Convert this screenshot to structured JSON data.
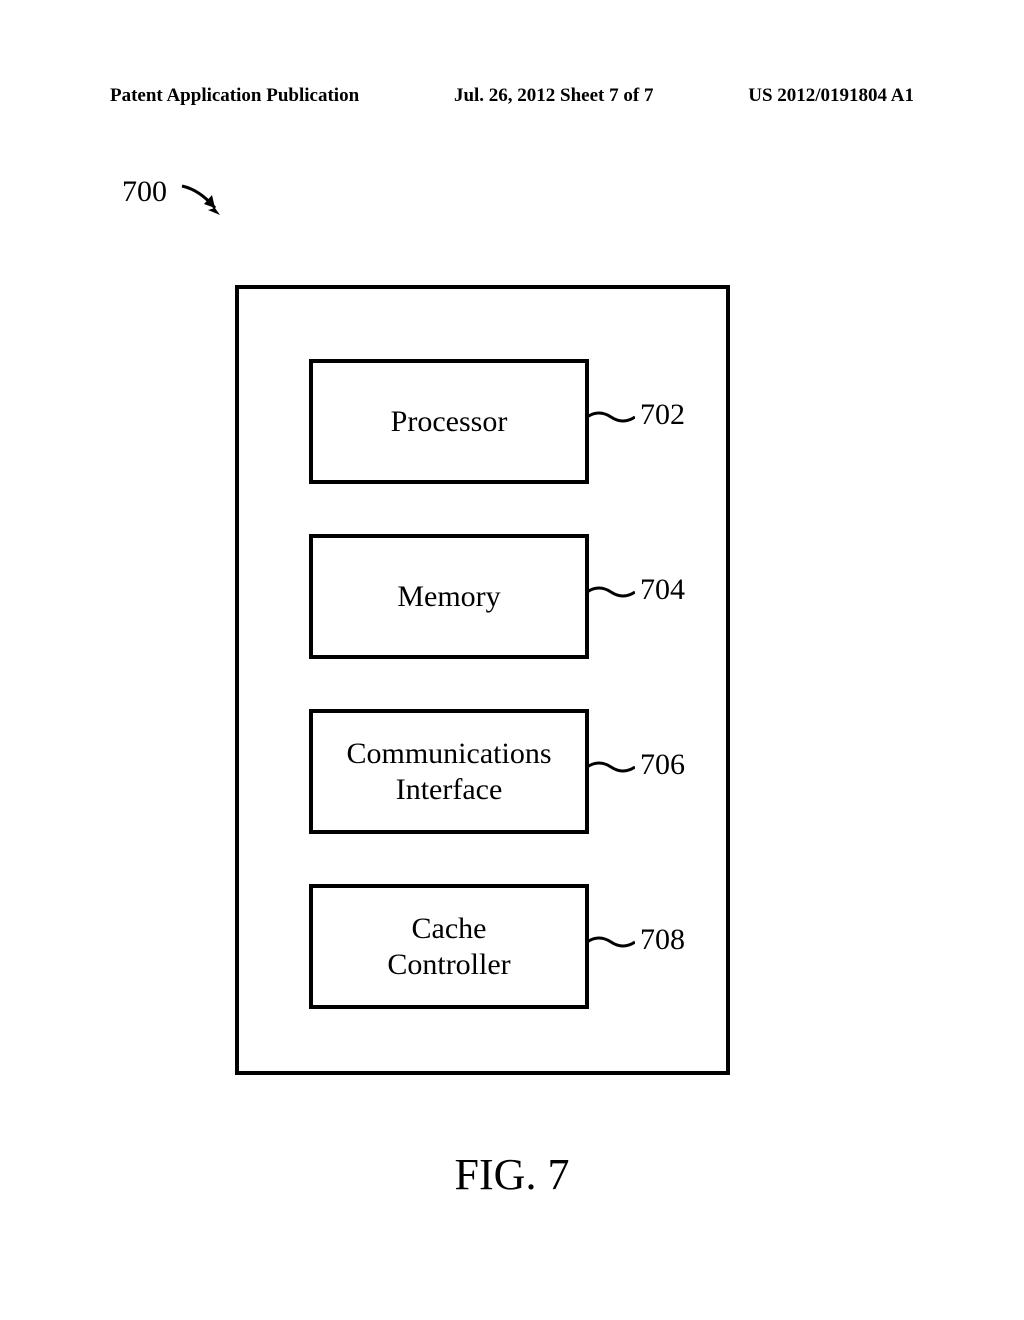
{
  "header": {
    "left": "Patent Application Publication",
    "center": "Jul. 26, 2012  Sheet 7 of 7",
    "right": "US 2012/0191804 A1"
  },
  "diagram": {
    "system_ref": "700",
    "figure_label": "FIG. 7",
    "blocks": [
      {
        "label": "Processor",
        "ref": "702"
      },
      {
        "label": "Memory",
        "ref": "704"
      },
      {
        "label": "Communications\nInterface",
        "ref": "706"
      },
      {
        "label": "Cache\nController",
        "ref": "708"
      }
    ]
  }
}
